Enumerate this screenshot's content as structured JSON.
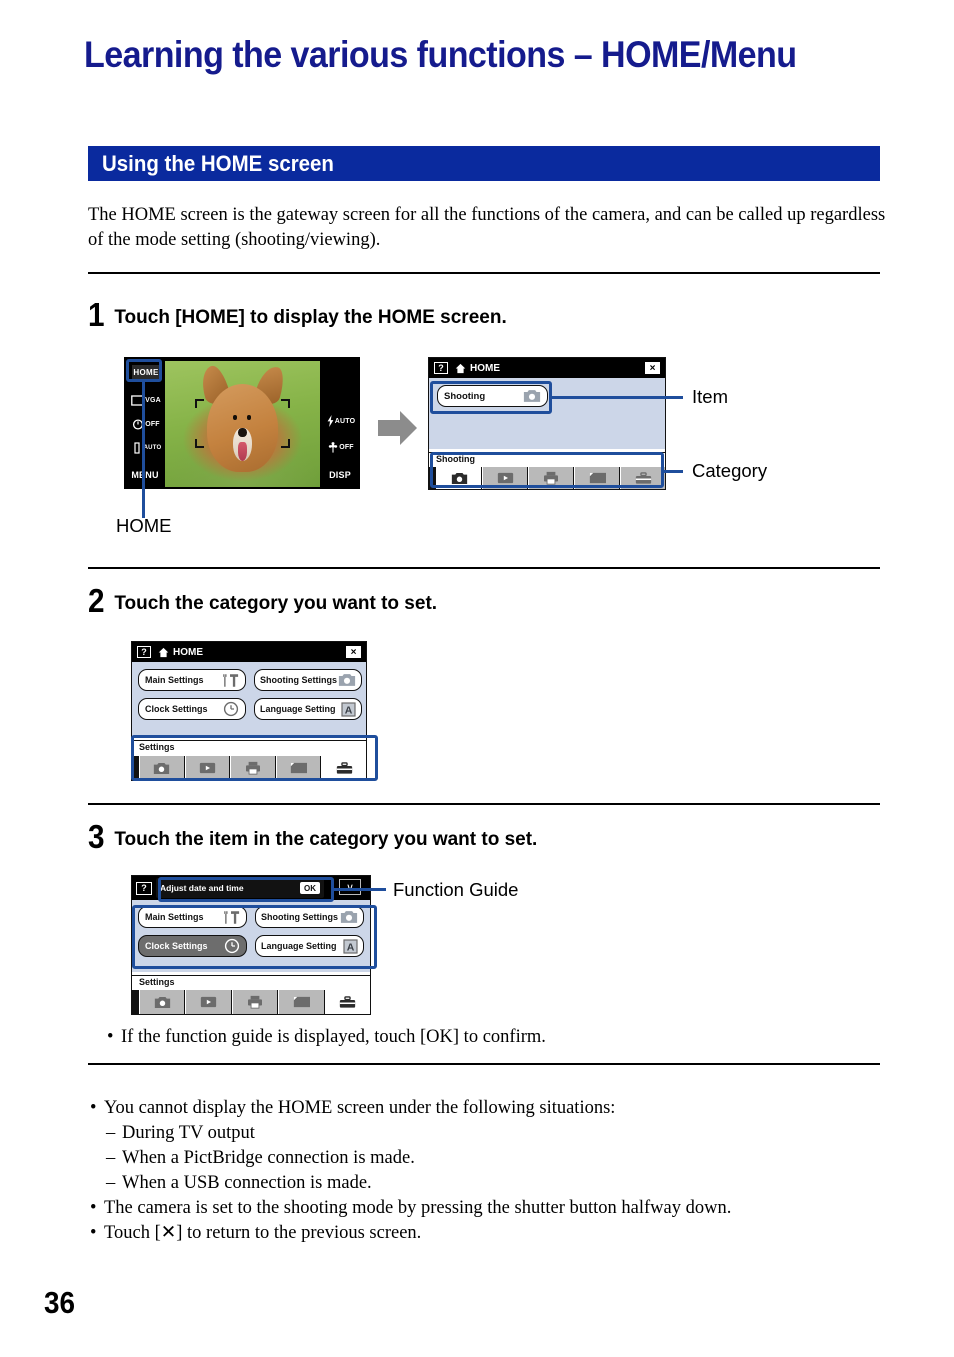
{
  "document": {
    "title": "Learning the various functions – HOME/Menu",
    "section_heading": "Using the HOME screen",
    "intro": "The HOME screen is the gateway screen for all the functions of the camera, and can be called up regardless of the mode setting (shooting/viewing).",
    "page_number": "36"
  },
  "steps": [
    {
      "number": "1",
      "text": "Touch [HOME] to display the HOME screen."
    },
    {
      "number": "2",
      "text": "Touch the category you want to set."
    },
    {
      "number": "3",
      "text": "Touch the item in the category you want to set."
    }
  ],
  "callouts": {
    "item": "Item",
    "category": "Category",
    "home": "HOME",
    "function_guide": "Function Guide"
  },
  "camera_lcd": {
    "home_key": "HOME",
    "menu_label": "MENU",
    "disp_label": "DISP",
    "flash_label": "AUTO",
    "macro_label": "OFF",
    "image_size_label": "VGA",
    "timer_label": "OFF",
    "iso_label": "AUTO",
    "photo_alt": "shiba-inu-dog-photo"
  },
  "home_screen_step1": {
    "title": "HOME",
    "help_badge": "?",
    "close_label": "×",
    "items": [
      {
        "label": "Shooting",
        "icon": "camera-icon",
        "selected": false,
        "highlighted": true
      }
    ],
    "category_label": "Shooting",
    "category_tabs": [
      {
        "icon": "camera-icon",
        "name": "shooting",
        "active": true
      },
      {
        "icon": "playback-icon",
        "name": "viewing",
        "active": false
      },
      {
        "icon": "printer-icon",
        "name": "printing",
        "active": false
      },
      {
        "icon": "memory-card-icon",
        "name": "manage-memory",
        "active": false
      },
      {
        "icon": "toolbox-icon",
        "name": "settings",
        "active": false
      }
    ]
  },
  "home_screen_step2": {
    "title": "HOME",
    "help_badge": "?",
    "close_label": "×",
    "items": [
      {
        "label": "Main Settings",
        "icon": "tools-icon",
        "selected": false
      },
      {
        "label": "Shooting Settings",
        "icon": "camera-icon",
        "selected": false
      },
      {
        "label": "Clock Settings",
        "icon": "clock-icon",
        "selected": false
      },
      {
        "label": "Language Setting",
        "icon": "language-a-icon",
        "selected": false
      }
    ],
    "category_label": "Settings",
    "category_tabs": [
      {
        "icon": "camera-icon",
        "name": "shooting",
        "active": false
      },
      {
        "icon": "playback-icon",
        "name": "viewing",
        "active": false
      },
      {
        "icon": "printer-icon",
        "name": "printing",
        "active": false
      },
      {
        "icon": "memory-card-icon",
        "name": "manage-memory",
        "active": false
      },
      {
        "icon": "toolbox-icon",
        "name": "settings",
        "active": true
      }
    ]
  },
  "home_screen_step3": {
    "help_badge": "?",
    "guide_text": "Adjust date and time",
    "guide_ok": "OK",
    "chevron": "∨",
    "items": [
      {
        "label": "Main Settings",
        "icon": "tools-icon",
        "selected": false
      },
      {
        "label": "Shooting Settings",
        "icon": "camera-icon",
        "selected": false
      },
      {
        "label": "Clock Settings",
        "icon": "clock-icon",
        "selected": true
      },
      {
        "label": "Language Setting",
        "icon": "language-a-icon",
        "selected": false
      }
    ],
    "category_label": "Settings",
    "category_tabs": [
      {
        "icon": "camera-icon",
        "name": "shooting",
        "active": false
      },
      {
        "icon": "playback-icon",
        "name": "viewing",
        "active": false
      },
      {
        "icon": "printer-icon",
        "name": "printing",
        "active": false
      },
      {
        "icon": "memory-card-icon",
        "name": "manage-memory",
        "active": false
      },
      {
        "icon": "toolbox-icon",
        "name": "settings",
        "active": true
      }
    ]
  },
  "step3_note": "If the function guide is displayed, touch [OK] to confirm.",
  "footer_notes": {
    "b1": "You cannot display the HOME screen under the following situations:",
    "b1_sub1": "During TV output",
    "b1_sub2": "When a PictBridge connection is made.",
    "b1_sub3": "When a USB connection is made.",
    "b2": "The camera is set to the shooting mode by pressing the shutter button halfway down.",
    "b3": "Touch [✕] to return to the previous screen."
  },
  "colors": {
    "title_blue": "#151B8D",
    "section_blue": "#0A2A9E",
    "leader_blue": "#1F4E9C",
    "lcd_body_blue": "#ccd6e8",
    "arrow_gray": "#8c8c8c"
  }
}
